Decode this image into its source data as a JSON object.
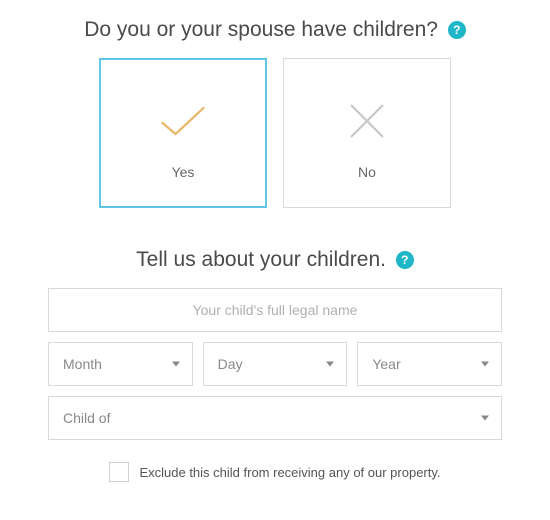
{
  "q1": {
    "text": "Do you or your spouse have children?",
    "help": "?"
  },
  "choices": {
    "yes_label": "Yes",
    "no_label": "No"
  },
  "q2": {
    "text": "Tell us about your children.",
    "help": "?"
  },
  "form": {
    "name_placeholder": "Your child's full legal name",
    "month_label": "Month",
    "day_label": "Day",
    "year_label": "Year",
    "childof_label": "Child of"
  },
  "exclude": {
    "label": "Exclude this child from receiving any of our property."
  }
}
